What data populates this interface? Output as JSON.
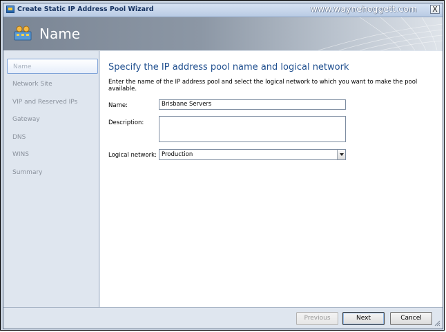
{
  "window": {
    "title": "Create Static IP Address Pool Wizard",
    "watermark": "www.waynehoggett.com",
    "close_label": "X"
  },
  "header": {
    "title": "Name",
    "icon": "ip-pool-icon"
  },
  "sidebar": {
    "items": [
      {
        "label": "Name",
        "active": true
      },
      {
        "label": "Network Site"
      },
      {
        "label": "VIP and Reserved IPs"
      },
      {
        "label": "Gateway"
      },
      {
        "label": "DNS"
      },
      {
        "label": "WINS"
      },
      {
        "label": "Summary"
      }
    ]
  },
  "content": {
    "heading": "Specify the IP address pool name and logical network",
    "description": "Enter the name of the IP address pool and select the logical network to which you want to make the pool available.",
    "name_label": "Name:",
    "name_value": "Brisbane Servers",
    "description_label": "Description:",
    "description_value": "",
    "network_label": "Logical network:",
    "network_value": "Production"
  },
  "footer": {
    "previous_label": "Previous",
    "next_label": "Next",
    "cancel_label": "Cancel"
  },
  "colors": {
    "accent": "#1f4f8f",
    "sidebar_bg": "#dfe6ef"
  }
}
